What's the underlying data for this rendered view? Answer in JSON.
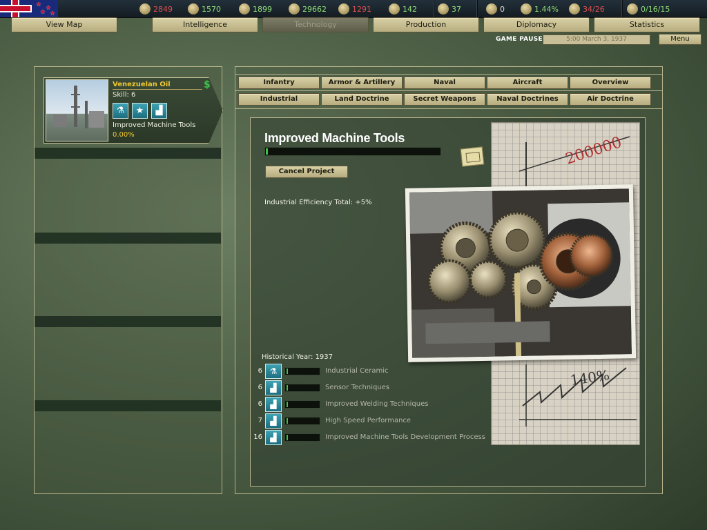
{
  "resources": [
    {
      "icon": "energy-icon",
      "value": "2849",
      "color": "red"
    },
    {
      "icon": "metal-icon",
      "value": "1570",
      "color": "green"
    },
    {
      "icon": "rare-materials-icon",
      "value": "1899",
      "color": "green"
    },
    {
      "icon": "oil-icon",
      "value": "29662",
      "color": "green"
    },
    {
      "icon": "supplies-icon",
      "value": "1291",
      "color": "red"
    },
    {
      "icon": "money-icon",
      "value": "142",
      "color": "green"
    },
    {
      "icon": "manpower-icon",
      "value": "37",
      "color": "green"
    },
    {
      "icon": "transports-icon",
      "value": "0",
      "color": "white"
    },
    {
      "icon": "dissent-icon",
      "value": "1.44%",
      "color": "green"
    },
    {
      "icon": "convoys-icon",
      "value": "34/26",
      "color": "red"
    },
    {
      "icon": "officers-icon",
      "value": "0/16/15",
      "color": "green"
    }
  ],
  "main_tabs": [
    "View Map",
    "Intelligence",
    "Technology",
    "Production",
    "Diplomacy",
    "Statistics"
  ],
  "status": {
    "paused": "GAME PAUSED",
    "date": "5:00 March 3, 1937",
    "menu": "Menu"
  },
  "team": {
    "name": "Venezuelan Oil",
    "skill": "Skill: 6",
    "task": "Improved Machine Tools",
    "progress": "0.00%"
  },
  "category_tabs_row1": [
    "Infantry",
    "Armor & Artillery",
    "Naval",
    "Aircraft",
    "Overview"
  ],
  "category_tabs_row2": [
    "Industrial",
    "Land Doctrine",
    "Secret Weapons",
    "Naval Doctrines",
    "Air Doctrine"
  ],
  "tech": {
    "title": "Improved Machine Tools",
    "progress_fraction": 0.01,
    "cancel_label": "Cancel Project",
    "effect": "Industrial Efficiency Total: +5%",
    "historical_year": "Historical Year: 1937"
  },
  "requirements": [
    {
      "level": "6",
      "icon": "flask-icon",
      "name": "Industrial Ceramic"
    },
    {
      "level": "6",
      "icon": "factory-icon",
      "name": "Sensor Techniques"
    },
    {
      "level": "6",
      "icon": "factory-icon",
      "name": "Improved Welding Techniques"
    },
    {
      "level": "7",
      "icon": "factory-icon",
      "name": "High Speed Performance"
    },
    {
      "level": "16",
      "icon": "factory-icon",
      "name": "Improved Machine Tools Development Process"
    }
  ]
}
